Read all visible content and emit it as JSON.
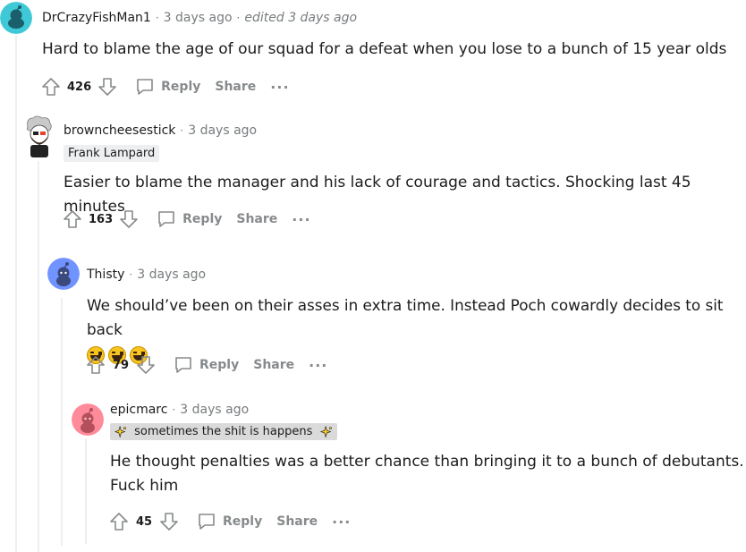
{
  "icons": {
    "upvote": "upvote-arrow-icon",
    "downvote": "downvote-arrow-icon",
    "reply": "speech-bubble-icon",
    "more": "ellipsis-icon",
    "emoji": "laughing-emoji-icon",
    "sparkle": "sparkles-icon"
  },
  "colors": {
    "muted": "#787c7e",
    "action": "#878a8c",
    "thread_line": "#edeff1",
    "flair_bg": "#edeff1"
  },
  "comments": [
    {
      "username": "DrCrazyFishMan1",
      "separator": "·",
      "time": "3 days ago",
      "edited": "edited 3 days ago",
      "body": [
        "Hard to blame the age of our squad for a defeat when you lose to a bunch of 15 year olds"
      ],
      "score": "426",
      "reply_label": "Reply",
      "share_label": "Share",
      "more_label": "···",
      "avatar_color": "#3fc8d6"
    },
    {
      "username": "browncheesestick",
      "separator": "·",
      "time": "3 days ago",
      "flair": "Frank Lampard",
      "body": [
        "Easier to blame the manager and his lack of courage and tactics. Shocking last 45 minutes"
      ],
      "score": "163",
      "reply_label": "Reply",
      "share_label": "Share",
      "more_label": "···"
    },
    {
      "username": "Thisty",
      "separator": "·",
      "time": "3 days ago",
      "body": [
        "We should’ve been on their asses in extra time. Instead Poch cowardly decides to sit back"
      ],
      "emoji_count": 3,
      "score": "79",
      "reply_label": "Reply",
      "share_label": "Share",
      "more_label": "···",
      "avatar_color": "#7193ff"
    },
    {
      "username": "epicmarc",
      "separator": "·",
      "time": "3 days ago",
      "flair": "sometimes the shit is happens",
      "body": [
        "He thought penalties was a better chance than bringing it to a bunch of debutants.",
        "Fuck him"
      ],
      "score": "45",
      "reply_label": "Reply",
      "share_label": "Share",
      "more_label": "···",
      "avatar_color": "#ff8b9a"
    }
  ]
}
